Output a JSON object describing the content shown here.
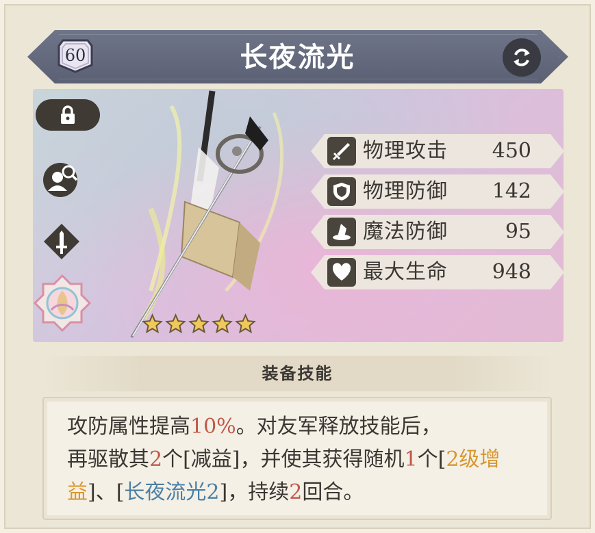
{
  "item": {
    "level": "60",
    "name": "长夜流光",
    "rarity_stars": 5
  },
  "stats": [
    {
      "icon": "sword-icon",
      "label": "物理攻击",
      "value": "450"
    },
    {
      "icon": "shield-icon",
      "label": "物理防御",
      "value": "142"
    },
    {
      "icon": "wizard-hat-icon",
      "label": "魔法防御",
      "value": "95"
    },
    {
      "icon": "heart-icon",
      "label": "最大生命",
      "value": "948"
    }
  ],
  "skill": {
    "header": "装备技能",
    "segments": [
      {
        "text": "攻防属性提高",
        "style": "normal"
      },
      {
        "text": "10%",
        "style": "red"
      },
      {
        "text": "。对友军释放技能后，",
        "style": "normal"
      },
      {
        "text": "再驱散其",
        "style": "normal"
      },
      {
        "text": "2",
        "style": "red"
      },
      {
        "text": "个[减益]，并使其获得随机",
        "style": "normal"
      },
      {
        "text": "1",
        "style": "red"
      },
      {
        "text": "个[",
        "style": "normal"
      },
      {
        "text": "2级增益",
        "style": "gold"
      },
      {
        "text": "]、[",
        "style": "normal"
      },
      {
        "text": "长夜流光2",
        "style": "blue"
      },
      {
        "text": "]，持续",
        "style": "normal"
      },
      {
        "text": "2",
        "style": "red"
      },
      {
        "text": "回合。",
        "style": "normal"
      }
    ]
  },
  "colors": {
    "banner": "#5b6074",
    "stat_icon_bg": "#4a453c",
    "highlight_red": "#c0584a",
    "highlight_gold": "#d8962f",
    "highlight_blue": "#4a7fa5"
  }
}
